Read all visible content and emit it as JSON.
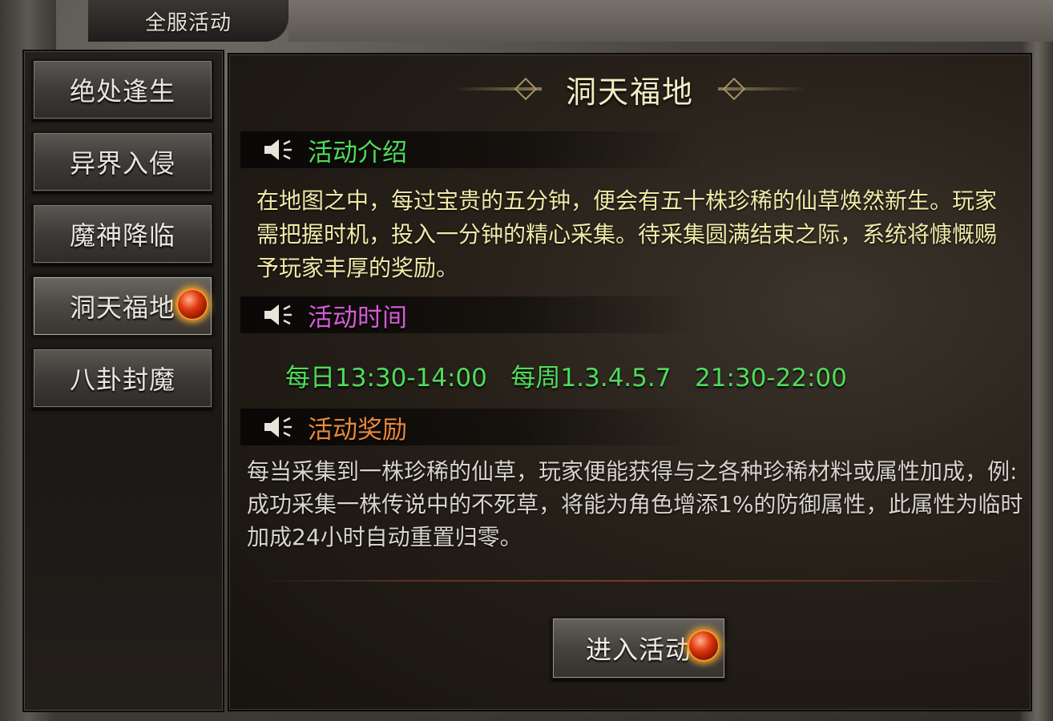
{
  "window": {
    "title": "全服活动"
  },
  "sidebar": {
    "items": [
      {
        "label": "绝处逢生"
      },
      {
        "label": "异界入侵"
      },
      {
        "label": "魔神降临"
      },
      {
        "label": "洞天福地"
      },
      {
        "label": "八卦封魔"
      }
    ],
    "active_index": 3
  },
  "main": {
    "title": "洞天福地",
    "intro": {
      "heading": "活动介绍",
      "text": "在地图之中，每过宝贵的五分钟，便会有五十株珍稀的仙草焕然新生。玩家需把握时机，投入一分钟的精心采集。待采集圆满结束之际，系统将慷慨赐予玩家丰厚的奖励。"
    },
    "time": {
      "heading": "活动时间",
      "text": "每日13:30-14:00   每周1.3.4.5.7   21:30-22:00"
    },
    "reward": {
      "heading": "活动奖励",
      "text": "每当采集到一株珍稀的仙草，玩家便能获得与之各种珍稀材料或属性加成，例:成功采集一株传说中的不死草，将能为角色增添1%的防御属性，此属性为临时加成24小时自动重置归零。"
    },
    "enter_button": "进入活动"
  },
  "colors": {
    "intro_heading": "#4fdc5a",
    "time_heading": "#d65bd6",
    "reward_heading": "#e8883a",
    "intro_text": "#f2e9a8",
    "reward_text": "#d8d4cc",
    "time_text": "#4fdc5a"
  },
  "icons": [
    "speaker-icon",
    "notification-orb-icon",
    "diamond-ornament-icon"
  ]
}
